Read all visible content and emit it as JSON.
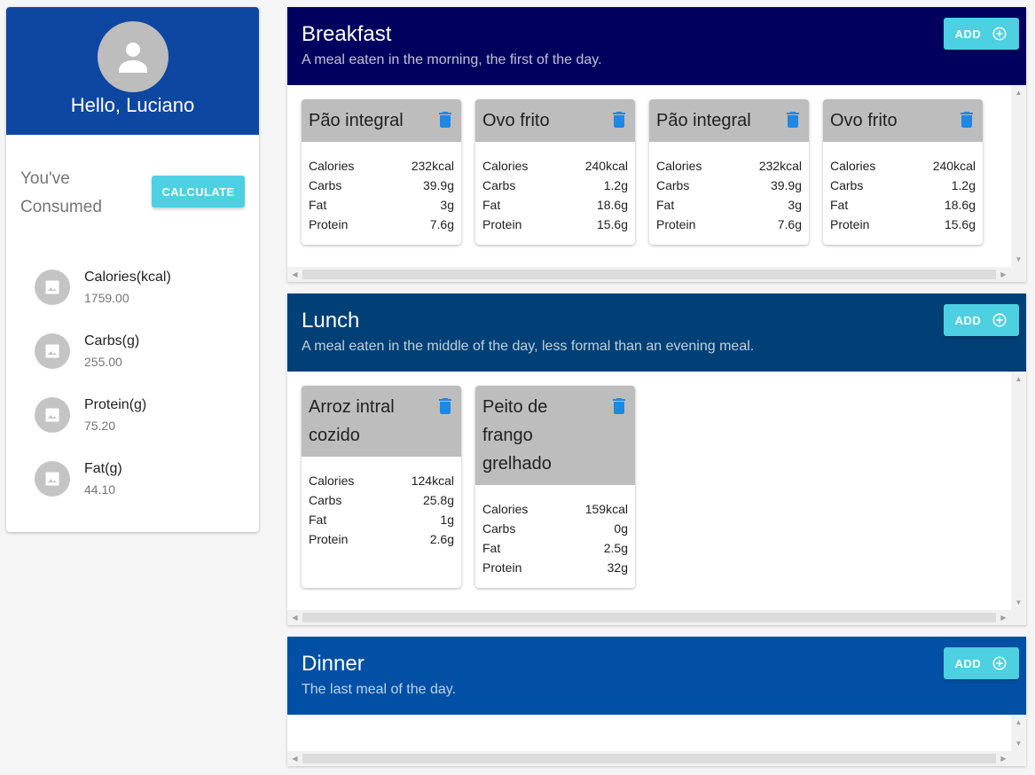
{
  "sidebar": {
    "greeting": "Hello, Luciano",
    "consumed_title": "You've Consumed",
    "calculate_label": "CALCULATE",
    "nutrients": [
      {
        "label": "Calories(kcal)",
        "value": "1759.00"
      },
      {
        "label": "Carbs(g)",
        "value": "255.00"
      },
      {
        "label": "Protein(g)",
        "value": "75.20"
      },
      {
        "label": "Fat(g)",
        "value": "44.10"
      }
    ]
  },
  "colors": {
    "sidebar_header": "#0d47a1",
    "breakfast_header": "#01005e",
    "lunch_header": "#004076",
    "dinner_header": "#0150a5",
    "accent": "#4dd0e1",
    "trash_icon": "#1e88e5"
  },
  "meals": {
    "breakfast": {
      "title": "Breakfast",
      "description": "A meal eaten in the morning, the first of the day.",
      "add_label": "ADD",
      "items": [
        {
          "name": "Pão integral",
          "calories": "232kcal",
          "carbs": "39.9g",
          "fat": "3g",
          "protein": "7.6g"
        },
        {
          "name": "Ovo frito",
          "calories": "240kcal",
          "carbs": "1.2g",
          "fat": "18.6g",
          "protein": "15.6g"
        },
        {
          "name": "Pão integral",
          "calories": "232kcal",
          "carbs": "39.9g",
          "fat": "3g",
          "protein": "7.6g"
        },
        {
          "name": "Ovo frito",
          "calories": "240kcal",
          "carbs": "1.2g",
          "fat": "18.6g",
          "protein": "15.6g"
        }
      ]
    },
    "lunch": {
      "title": "Lunch",
      "description": "A meal eaten in the middle of the day, less formal than an evening meal.",
      "add_label": "ADD",
      "items": [
        {
          "name": "Arroz intral cozido",
          "calories": "124kcal",
          "carbs": "25.8g",
          "fat": "1g",
          "protein": "2.6g"
        },
        {
          "name": "Peito de frango grelhado",
          "calories": "159kcal",
          "carbs": "0g",
          "fat": "2.5g",
          "protein": "32g"
        }
      ]
    },
    "dinner": {
      "title": "Dinner",
      "description": "The last meal of the day.",
      "add_label": "ADD",
      "items": []
    }
  },
  "labels": {
    "calories": "Calories",
    "carbs": "Carbs",
    "fat": "Fat",
    "protein": "Protein"
  }
}
